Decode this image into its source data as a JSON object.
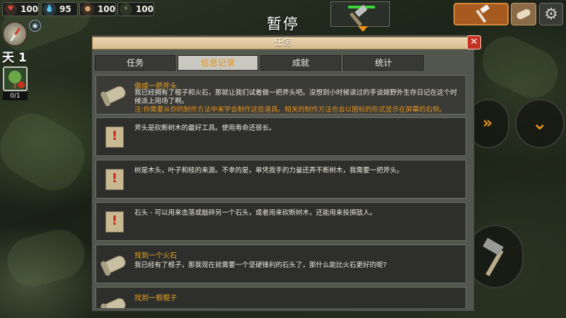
{
  "hud": {
    "stats": [
      {
        "name": "health",
        "icon": "heart-icon",
        "value": "100"
      },
      {
        "name": "thirst",
        "icon": "water-drop-icon",
        "value": "95"
      },
      {
        "name": "hunger",
        "icon": "food-icon",
        "value": "100"
      },
      {
        "name": "energy",
        "icon": "energy-icon",
        "value": "100"
      }
    ],
    "pause_title": "暂停",
    "tool_durability": 1.0,
    "day_label": "天 1",
    "slot_count": "0/1"
  },
  "dialog": {
    "title": "任务",
    "close_label": "✕",
    "tabs": [
      {
        "label": "任务",
        "active": false
      },
      {
        "label": "信息记录",
        "active": true
      },
      {
        "label": "成就",
        "active": false
      },
      {
        "label": "统计",
        "active": false
      }
    ],
    "entries": [
      {
        "icon": "scroll-icon",
        "title": "做成一把斧头",
        "body": "我已经拥有了棍子和火石，那就让我们试着做一把斧头吧。没想到小时候读过的手谈姬野外生存日记在这个时候派上用场了啊。",
        "note": "注:你需要从你的制作方法中来学会制作这些道具。相关的制作方法也会以图标的形式显示在屏幕的右侧。"
      },
      {
        "icon": "note-icon",
        "title": "",
        "body": "斧头是砍断树木的最好工具。使用寿命还很长。",
        "note": ""
      },
      {
        "icon": "note-icon",
        "title": "",
        "body": "树是木头，叶子和枝的来源。不幸的是，单凭我手的力量还弄不断树木，我需要一把斧头。",
        "note": ""
      },
      {
        "icon": "note-icon",
        "title": "",
        "body": "石头 - 可以用来击落或敲碎另一个石头，或者用来砍断树木，还能用来投掷敌人。",
        "note": ""
      },
      {
        "icon": "scroll-icon",
        "title": "找到一个火石",
        "body": "我已经有了棍子，那我现在就需要一个坚硬锋利的石头了，那什么能比火石更好的呢?",
        "note": ""
      },
      {
        "icon": "scroll-icon",
        "title": "找到一根棍子",
        "body": "",
        "note": ""
      }
    ]
  }
}
